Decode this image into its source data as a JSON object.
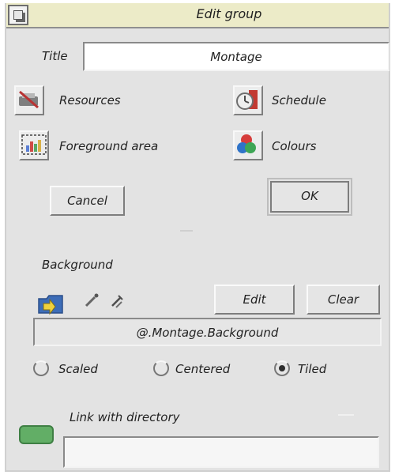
{
  "window": {
    "title": "Edit group"
  },
  "title_field": {
    "label": "Title",
    "value": "Montage"
  },
  "options": [
    {
      "label": "Resources",
      "icon": "resources-icon"
    },
    {
      "label": "Schedule",
      "icon": "schedule-icon"
    },
    {
      "label": "Foreground area",
      "icon": "foreground-area-icon"
    },
    {
      "label": "Colours",
      "icon": "colours-icon"
    }
  ],
  "buttons": {
    "cancel": "Cancel",
    "ok": "OK",
    "edit": "Edit",
    "clear": "Clear"
  },
  "background": {
    "label": "Background",
    "path": "@.Montage.Background",
    "modes": [
      {
        "label": "Scaled",
        "checked": false
      },
      {
        "label": "Centered",
        "checked": false
      },
      {
        "label": "Tiled",
        "checked": true
      }
    ]
  },
  "link": {
    "label": "Link with directory"
  },
  "colors": {
    "window_bg": "#e3e3e3",
    "titlebar_bg": "#ecebc8",
    "field_bg": "#ffffff",
    "accent_green": "#62ae66"
  }
}
